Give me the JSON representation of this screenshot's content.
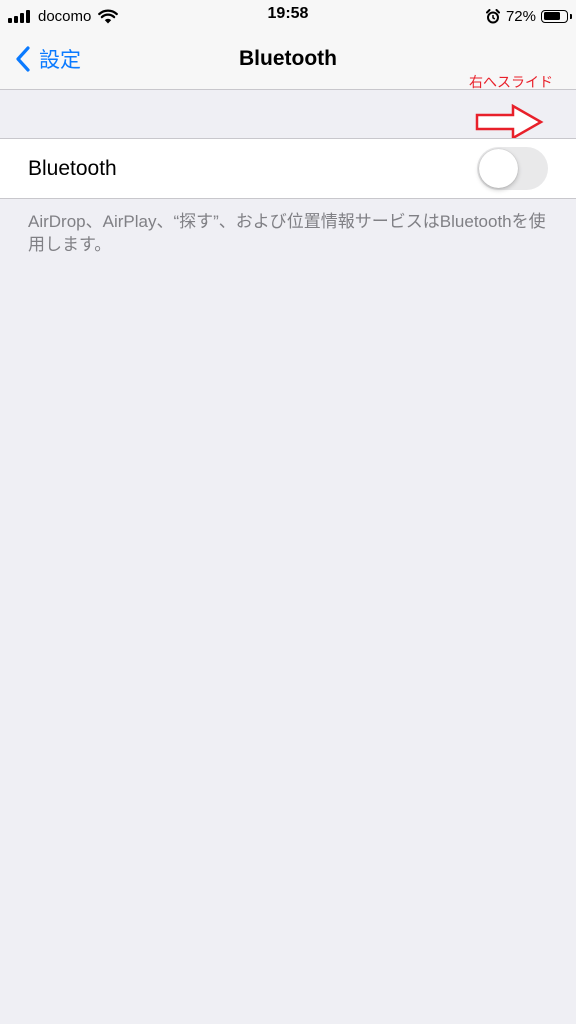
{
  "status_bar": {
    "carrier": "docomo",
    "time": "19:58",
    "battery_percent": "72%",
    "battery_level": 0.72,
    "icons": [
      "signal-bars-icon",
      "wifi-icon",
      "alarm-icon",
      "battery-icon"
    ]
  },
  "nav_bar": {
    "back_label": "設定",
    "title": "Bluetooth"
  },
  "annotation": {
    "text": "右へスライド",
    "color": "#e8202a"
  },
  "bluetooth_row": {
    "label": "Bluetooth",
    "toggle_on": false
  },
  "footer": {
    "description": "AirDrop、AirPlay、“探す”、および位置情報サービスはBluetoothを使用します。"
  },
  "colors": {
    "accent": "#0a7aff",
    "background": "#efeff4",
    "annotation": "#e8202a"
  }
}
